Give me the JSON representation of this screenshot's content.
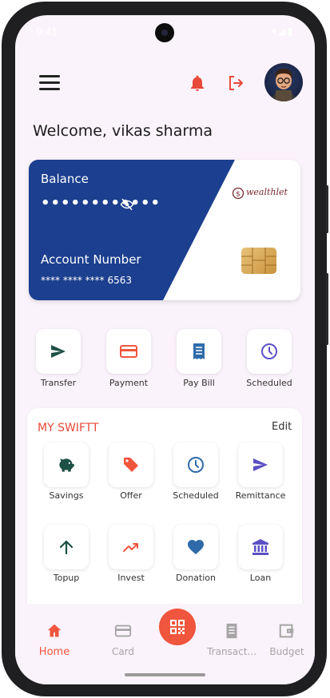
{
  "status_bar": {
    "time": "9:41",
    "icons": "▾◢▮"
  },
  "header": {
    "menu_icon": "hamburger-menu-icon",
    "bell_icon": "bell-icon",
    "logout_icon": "logout-icon",
    "avatar_icon": "avatar"
  },
  "welcome_text": "Welcome,  vikas sharma",
  "balance_card": {
    "balance_label": "Balance",
    "balance_masked": "••••••••••••",
    "visibility_icon": "eye-off-icon",
    "account_label": "Account Number",
    "account_masked": "**** **** **** 6563",
    "brand_name": "wealthlet",
    "card_color": "#1c3f8f"
  },
  "quick_actions": [
    {
      "label": "Transfer",
      "icon": "send-icon",
      "color": "#1e5145"
    },
    {
      "label": "Payment",
      "icon": "credit-card-icon",
      "color": "#f0553d"
    },
    {
      "label": "Pay Bill",
      "icon": "receipt-icon",
      "color": "#2f6ba8"
    },
    {
      "label": "Scheduled",
      "icon": "clock-icon",
      "color": "#5b51c4"
    }
  ],
  "my_swiftt": {
    "title": "MY SWIFTT",
    "edit_label": "Edit",
    "items": [
      {
        "label": "Savings",
        "icon": "piggy-bank-icon",
        "color": "#1e5145"
      },
      {
        "label": "Offer",
        "icon": "tag-icon",
        "color": "#f0553d"
      },
      {
        "label": "Scheduled",
        "icon": "clock-icon",
        "color": "#2f6ba8"
      },
      {
        "label": "Remittance",
        "icon": "send-icon",
        "color": "#5b51c4"
      },
      {
        "label": "Topup",
        "icon": "arrow-up-icon",
        "color": "#1e5145"
      },
      {
        "label": "Invest",
        "icon": "trending-up-icon",
        "color": "#f0553d"
      },
      {
        "label": "Donation",
        "icon": "heart-icon",
        "color": "#2f6ba8"
      },
      {
        "label": "Loan",
        "icon": "bank-icon",
        "color": "#5b51c4"
      }
    ]
  },
  "bottom_nav": {
    "items": [
      {
        "label": "Home",
        "icon": "home-icon",
        "active": true
      },
      {
        "label": "Card",
        "icon": "card-icon",
        "active": false
      },
      {
        "label": "Transact...",
        "icon": "receipt-icon",
        "active": false
      },
      {
        "label": "Budget",
        "icon": "wallet-icon",
        "active": false
      }
    ],
    "qr_icon": "qr-code-icon",
    "active_color": "#f0553d",
    "inactive_color": "#a5a5a5"
  }
}
